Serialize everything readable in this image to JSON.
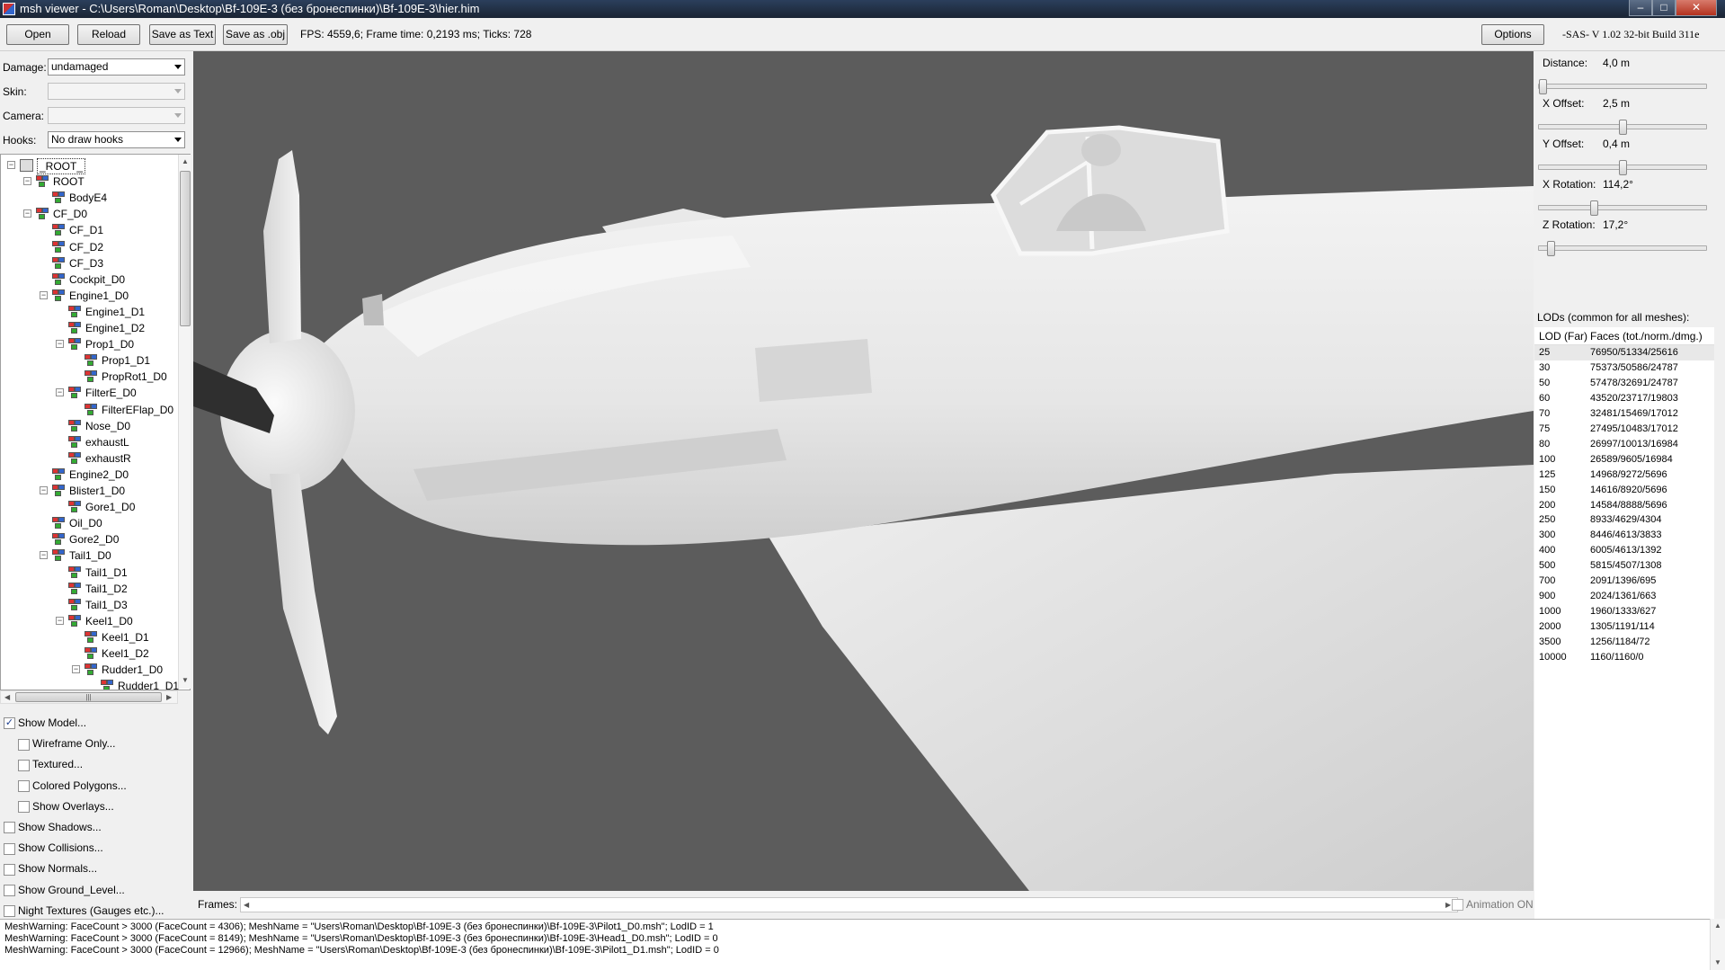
{
  "window": {
    "title": "msh viewer - C:\\Users\\Roman\\Desktop\\Bf-109E-3 (без бронеспинки)\\Bf-109E-3\\hier.him",
    "min_glyph": "–",
    "max_glyph": "□",
    "close_glyph": "✕"
  },
  "toolbar": {
    "open": "Open",
    "reload": "Reload",
    "save_text": "Save as Text",
    "save_obj": "Save as .obj",
    "stats": "FPS: 4559,6; Frame time: 0,2193 ms; Ticks: 728",
    "options": "Options",
    "version": "-SAS- V 1.02  32-bit  Build 311e"
  },
  "controls": {
    "damage_label": "Damage:",
    "damage_value": "undamaged",
    "skin_label": "Skin:",
    "skin_value": "",
    "camera_label": "Camera:",
    "camera_value": "",
    "hooks_label": "Hooks:",
    "hooks_value": "No draw hooks"
  },
  "tree": [
    {
      "label": "_ROOT_",
      "level": 0,
      "expander": "−",
      "root": true
    },
    {
      "label": "ROOT",
      "level": 1,
      "expander": "−"
    },
    {
      "label": "BodyE4",
      "level": 2,
      "expander": ""
    },
    {
      "label": "CF_D0",
      "level": 1,
      "expander": "−"
    },
    {
      "label": "CF_D1",
      "level": 2,
      "expander": ""
    },
    {
      "label": "CF_D2",
      "level": 2,
      "expander": ""
    },
    {
      "label": "CF_D3",
      "level": 2,
      "expander": ""
    },
    {
      "label": "Cockpit_D0",
      "level": 2,
      "expander": ""
    },
    {
      "label": "Engine1_D0",
      "level": 2,
      "expander": "−"
    },
    {
      "label": "Engine1_D1",
      "level": 3,
      "expander": ""
    },
    {
      "label": "Engine1_D2",
      "level": 3,
      "expander": ""
    },
    {
      "label": "Prop1_D0",
      "level": 3,
      "expander": "−"
    },
    {
      "label": "Prop1_D1",
      "level": 4,
      "expander": ""
    },
    {
      "label": "PropRot1_D0",
      "level": 4,
      "expander": ""
    },
    {
      "label": "FilterE_D0",
      "level": 3,
      "expander": "−"
    },
    {
      "label": "FilterEFlap_D0",
      "level": 4,
      "expander": ""
    },
    {
      "label": "Nose_D0",
      "level": 3,
      "expander": ""
    },
    {
      "label": "exhaustL",
      "level": 3,
      "expander": ""
    },
    {
      "label": "exhaustR",
      "level": 3,
      "expander": ""
    },
    {
      "label": "Engine2_D0",
      "level": 2,
      "expander": ""
    },
    {
      "label": "Blister1_D0",
      "level": 2,
      "expander": "−"
    },
    {
      "label": "Gore1_D0",
      "level": 3,
      "expander": ""
    },
    {
      "label": "Oil_D0",
      "level": 2,
      "expander": ""
    },
    {
      "label": "Gore2_D0",
      "level": 2,
      "expander": ""
    },
    {
      "label": "Tail1_D0",
      "level": 2,
      "expander": "−"
    },
    {
      "label": "Tail1_D1",
      "level": 3,
      "expander": ""
    },
    {
      "label": "Tail1_D2",
      "level": 3,
      "expander": ""
    },
    {
      "label": "Tail1_D3",
      "level": 3,
      "expander": ""
    },
    {
      "label": "Keel1_D0",
      "level": 3,
      "expander": "−"
    },
    {
      "label": "Keel1_D1",
      "level": 4,
      "expander": ""
    },
    {
      "label": "Keel1_D2",
      "level": 4,
      "expander": ""
    },
    {
      "label": "Rudder1_D0",
      "level": 4,
      "expander": "−"
    },
    {
      "label": "Rudder1_D1",
      "level": 5,
      "expander": ""
    }
  ],
  "checkboxes": [
    {
      "label": "Show Model...",
      "checked": true,
      "indent": 0
    },
    {
      "label": "Wireframe Only...",
      "checked": false,
      "indent": 1
    },
    {
      "label": "Textured...",
      "checked": false,
      "indent": 1
    },
    {
      "label": "Colored Polygons...",
      "checked": false,
      "indent": 1
    },
    {
      "label": "Show Overlays...",
      "checked": false,
      "indent": 1
    },
    {
      "label": "Show Shadows...",
      "checked": false,
      "indent": 0
    },
    {
      "label": "Show Collisions...",
      "checked": false,
      "indent": 0
    },
    {
      "label": "Show Normals...",
      "checked": false,
      "indent": 0
    },
    {
      "label": "Show Ground_Level...",
      "checked": false,
      "indent": 0
    },
    {
      "label": "Night Textures (Gauges etc.)...",
      "checked": false,
      "indent": 0
    }
  ],
  "frames": {
    "label": "Frames:",
    "animation_label": "Animation ON",
    "animation_on": false
  },
  "camera_params": [
    {
      "label": "Distance:",
      "value": "4,0 m",
      "slider_pos": 0.0
    },
    {
      "label": "X Offset:",
      "value": "2,5 m",
      "slider_pos": 0.5
    },
    {
      "label": "Y Offset:",
      "value": "0,4 m",
      "slider_pos": 0.5
    },
    {
      "label": "X Rotation:",
      "value": "114,2°",
      "slider_pos": 0.32
    },
    {
      "label": "Z Rotation:",
      "value": "17,2°",
      "slider_pos": 0.05
    }
  ],
  "lods": {
    "title": "LODs (common for all meshes):",
    "col1": "LOD (Far)",
    "col2": "Faces (tot./norm./dmg.)",
    "rows": [
      {
        "lod": "25",
        "faces": "76950/51334/25616"
      },
      {
        "lod": "30",
        "faces": "75373/50586/24787"
      },
      {
        "lod": "50",
        "faces": "57478/32691/24787"
      },
      {
        "lod": "60",
        "faces": "43520/23717/19803"
      },
      {
        "lod": "70",
        "faces": "32481/15469/17012"
      },
      {
        "lod": "75",
        "faces": "27495/10483/17012"
      },
      {
        "lod": "80",
        "faces": "26997/10013/16984"
      },
      {
        "lod": "100",
        "faces": "26589/9605/16984"
      },
      {
        "lod": "125",
        "faces": "14968/9272/5696"
      },
      {
        "lod": "150",
        "faces": "14616/8920/5696"
      },
      {
        "lod": "200",
        "faces": "14584/8888/5696"
      },
      {
        "lod": "250",
        "faces": "8933/4629/4304"
      },
      {
        "lod": "300",
        "faces": "8446/4613/3833"
      },
      {
        "lod": "400",
        "faces": "6005/4613/1392"
      },
      {
        "lod": "500",
        "faces": "5815/4507/1308"
      },
      {
        "lod": "700",
        "faces": "2091/1396/695"
      },
      {
        "lod": "900",
        "faces": "2024/1361/663"
      },
      {
        "lod": "1000",
        "faces": "1960/1333/627"
      },
      {
        "lod": "2000",
        "faces": "1305/1191/114"
      },
      {
        "lod": "3500",
        "faces": "1256/1184/72"
      },
      {
        "lod": "10000",
        "faces": "1160/1160/0"
      }
    ]
  },
  "log": [
    "MeshWarning: FaceCount > 3000 (FaceCount = 4306); MeshName = \"Users\\Roman\\Desktop\\Bf-109E-3 (без бронеспинки)\\Bf-109E-3\\Pilot1_D0.msh\"; LodID = 1",
    "MeshWarning: FaceCount > 3000 (FaceCount = 8149); MeshName = \"Users\\Roman\\Desktop\\Bf-109E-3 (без бронеспинки)\\Bf-109E-3\\Head1_D0.msh\"; LodID = 0",
    "MeshWarning: FaceCount > 3000 (FaceCount = 12966); MeshName = \"Users\\Roman\\Desktop\\Bf-109E-3 (без бронеспинки)\\Bf-109E-3\\Pilot1_D1.msh\"; LodID = 0"
  ],
  "colors": {
    "viewport_bg": "#5c5c5c",
    "model": "#e4e4e4",
    "titlebar": "#1f2a3a"
  }
}
